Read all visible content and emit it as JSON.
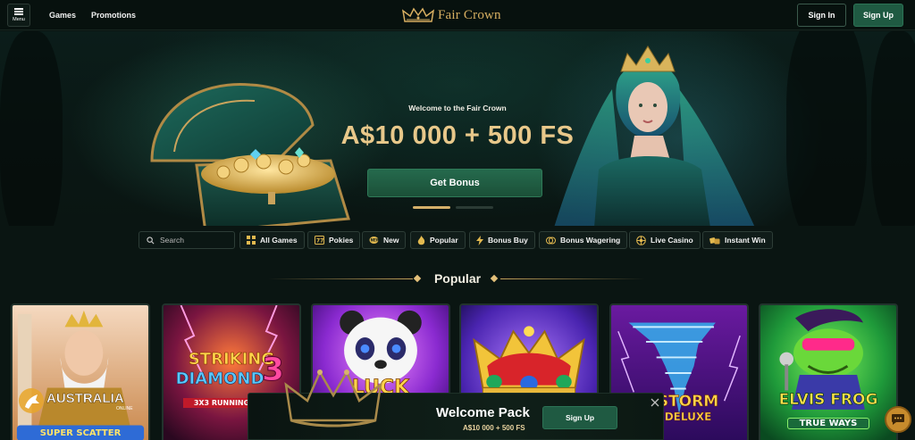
{
  "header": {
    "menu_label": "Menu",
    "nav": [
      "Games",
      "Promotions"
    ],
    "logo_text": "Fair Crown",
    "signin_label": "Sign In",
    "signup_label": "Sign Up"
  },
  "hero": {
    "subtitle": "Welcome to the Fair Crown",
    "title": "A$10 000 + 500 FS",
    "cta_label": "Get Bonus",
    "slide_count": 2,
    "active_slide": 1
  },
  "filters": {
    "search_placeholder": "Search",
    "chips": [
      {
        "label": "All Games",
        "icon": "grid-icon"
      },
      {
        "label": "Pokies",
        "icon": "slot-machine-icon"
      },
      {
        "label": "New",
        "icon": "new-badge-icon"
      },
      {
        "label": "Popular",
        "icon": "flame-icon"
      },
      {
        "label": "Bonus Buy",
        "icon": "lightning-icon"
      },
      {
        "label": "Bonus Wagering",
        "icon": "coins-icon"
      },
      {
        "label": "Live Casino",
        "icon": "roulette-icon"
      },
      {
        "label": "Instant Win",
        "icon": "dice-icon"
      }
    ]
  },
  "section": {
    "title": "Popular"
  },
  "games": [
    {
      "line1": "",
      "line2": "SUPER SCATTER",
      "icon": "zeus-art"
    },
    {
      "line1": "STRIKING",
      "line2": "DIAMOND",
      "line3": "3",
      "line4": "3X3 RUNNING",
      "icon": "diamond-art"
    },
    {
      "line1": "LUCK",
      "icon": "panda-art"
    },
    {
      "line1": "",
      "icon": "crown-art"
    },
    {
      "line1": "STORM",
      "line2": "DELUXE",
      "icon": "tornado-art"
    },
    {
      "line1": "ELVIS FROG",
      "line2": "TRUE WAYS",
      "icon": "frog-art"
    }
  ],
  "watermark": {
    "text": "AUSTRALIA",
    "sub": "ONLINE"
  },
  "promo": {
    "title": "Welcome Pack",
    "subtitle": "A$10 000 + 500 FS",
    "signup_label": "Sign Up"
  },
  "colors": {
    "accent_gold": "#e8c88a",
    "primary_green": "#1f5a42",
    "background": "#0a1512"
  }
}
